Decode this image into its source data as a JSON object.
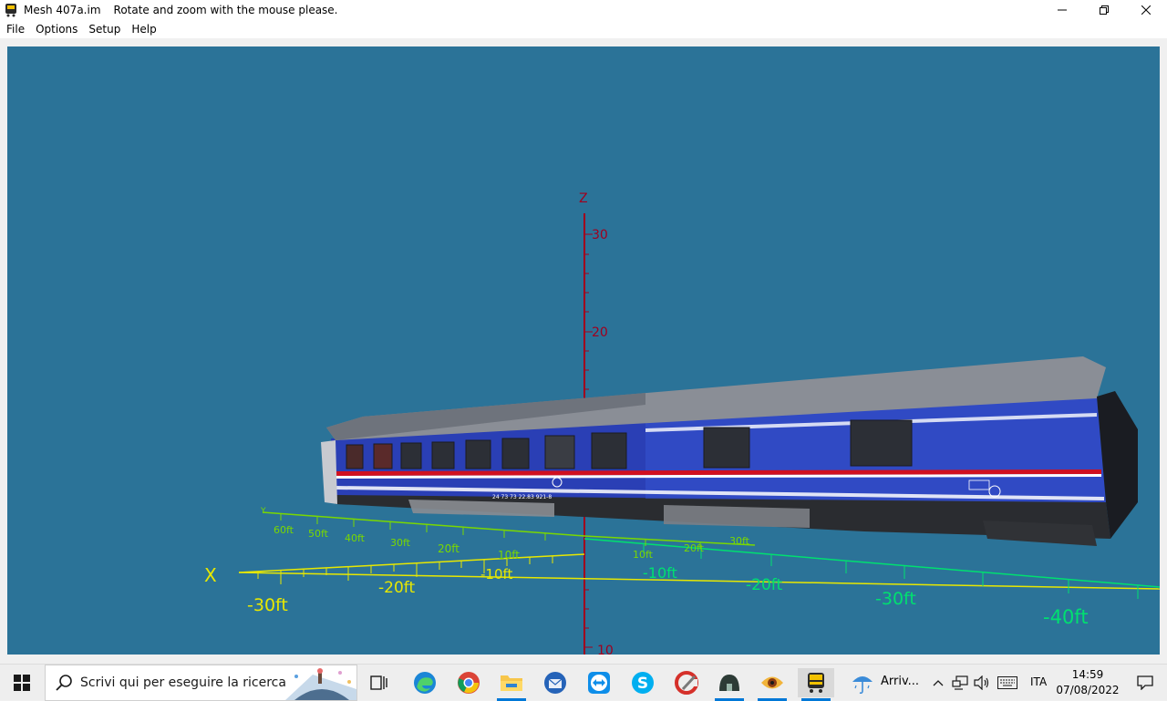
{
  "window": {
    "title": "Mesh 407a.im",
    "hint": "Rotate and zoom with the mouse please.",
    "controls": [
      "minimize",
      "restore",
      "close"
    ]
  },
  "menu": {
    "file": "File",
    "options": "Options",
    "setup": "Setup",
    "help": "Help"
  },
  "viewport": {
    "background": "#2b7398",
    "z_axis": {
      "label": "Z",
      "ticks": [
        "30",
        "20",
        "10",
        "10"
      ]
    },
    "x_axis": {
      "label": "X",
      "ticks": [
        "-30ft",
        "-20ft",
        "-10ft",
        "-10ft",
        "-20ft",
        "-30ft",
        "-40ft"
      ]
    },
    "y_axis": {
      "label": "Y",
      "ticks": [
        "60ft",
        "50ft",
        "40ft",
        "30ft",
        "20ft",
        "10ft",
        "10ft",
        "20ft",
        "30ft"
      ]
    },
    "colors": {
      "z_axis": "#a0001e",
      "x_axis": "#e8e800",
      "y_axis": "#7ad800",
      "ground_axis": "#00e070"
    },
    "model": {
      "name": "passenger coach",
      "body_color": "#2a3fb5",
      "roof_color": "#8a8e96",
      "stripe_color": "#d01020",
      "car_number": "24 73 73 22.83 921-8"
    }
  },
  "taskbar": {
    "search_placeholder": "Scrivi qui per eseguire la ricerca",
    "weather_text": "Arriv...",
    "language": "ITA",
    "time": "14:59",
    "date": "07/08/2022",
    "icons": [
      "start-icon",
      "task-view-icon",
      "edge-icon",
      "chrome-icon",
      "file-explorer-icon",
      "thunderbird-icon",
      "teamviewer-icon",
      "skype-icon",
      "ccleaner-icon",
      "app-dome-icon",
      "eye-app-icon",
      "trainz-icon",
      "weather-icon"
    ]
  }
}
